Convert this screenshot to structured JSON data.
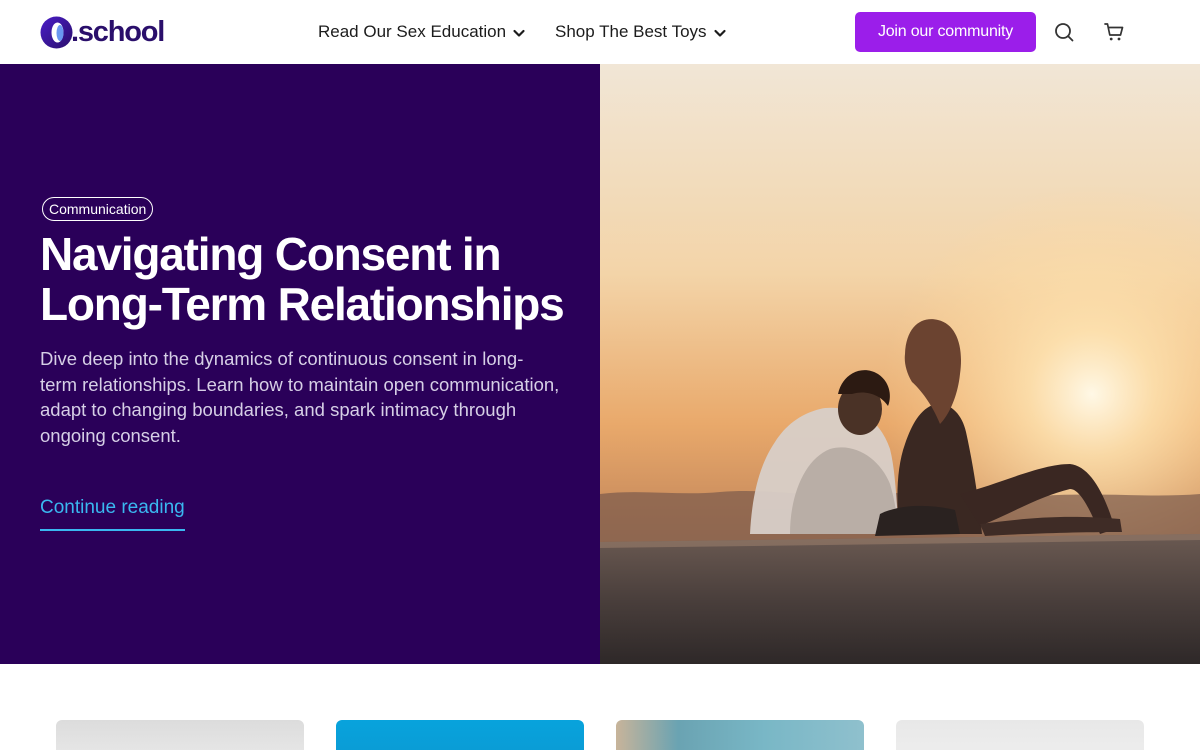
{
  "header": {
    "logo_text": ".school",
    "nav": [
      {
        "label": "Read Our Sex Education",
        "icon": "chevron-down-icon"
      },
      {
        "label": "Shop The Best Toys",
        "icon": "chevron-down-icon"
      }
    ],
    "join_label": "Join our community",
    "icons": [
      "search-icon",
      "cart-icon"
    ]
  },
  "hero": {
    "tag": "Communication",
    "headline": "Navigating Consent in Long-Term Relationships",
    "description": "Dive deep into the dynamics of continuous consent in long-term relationships. Learn how to maintain open communication, adapt to changing boundaries, and spark intimacy through ongoing consent.",
    "cta": "Continue reading"
  },
  "colors": {
    "brand_purple": "#9b1eea",
    "hero_background": "#2a0059",
    "link_blue": "#3ab8f0",
    "logo_navy": "#2a0f6b"
  }
}
